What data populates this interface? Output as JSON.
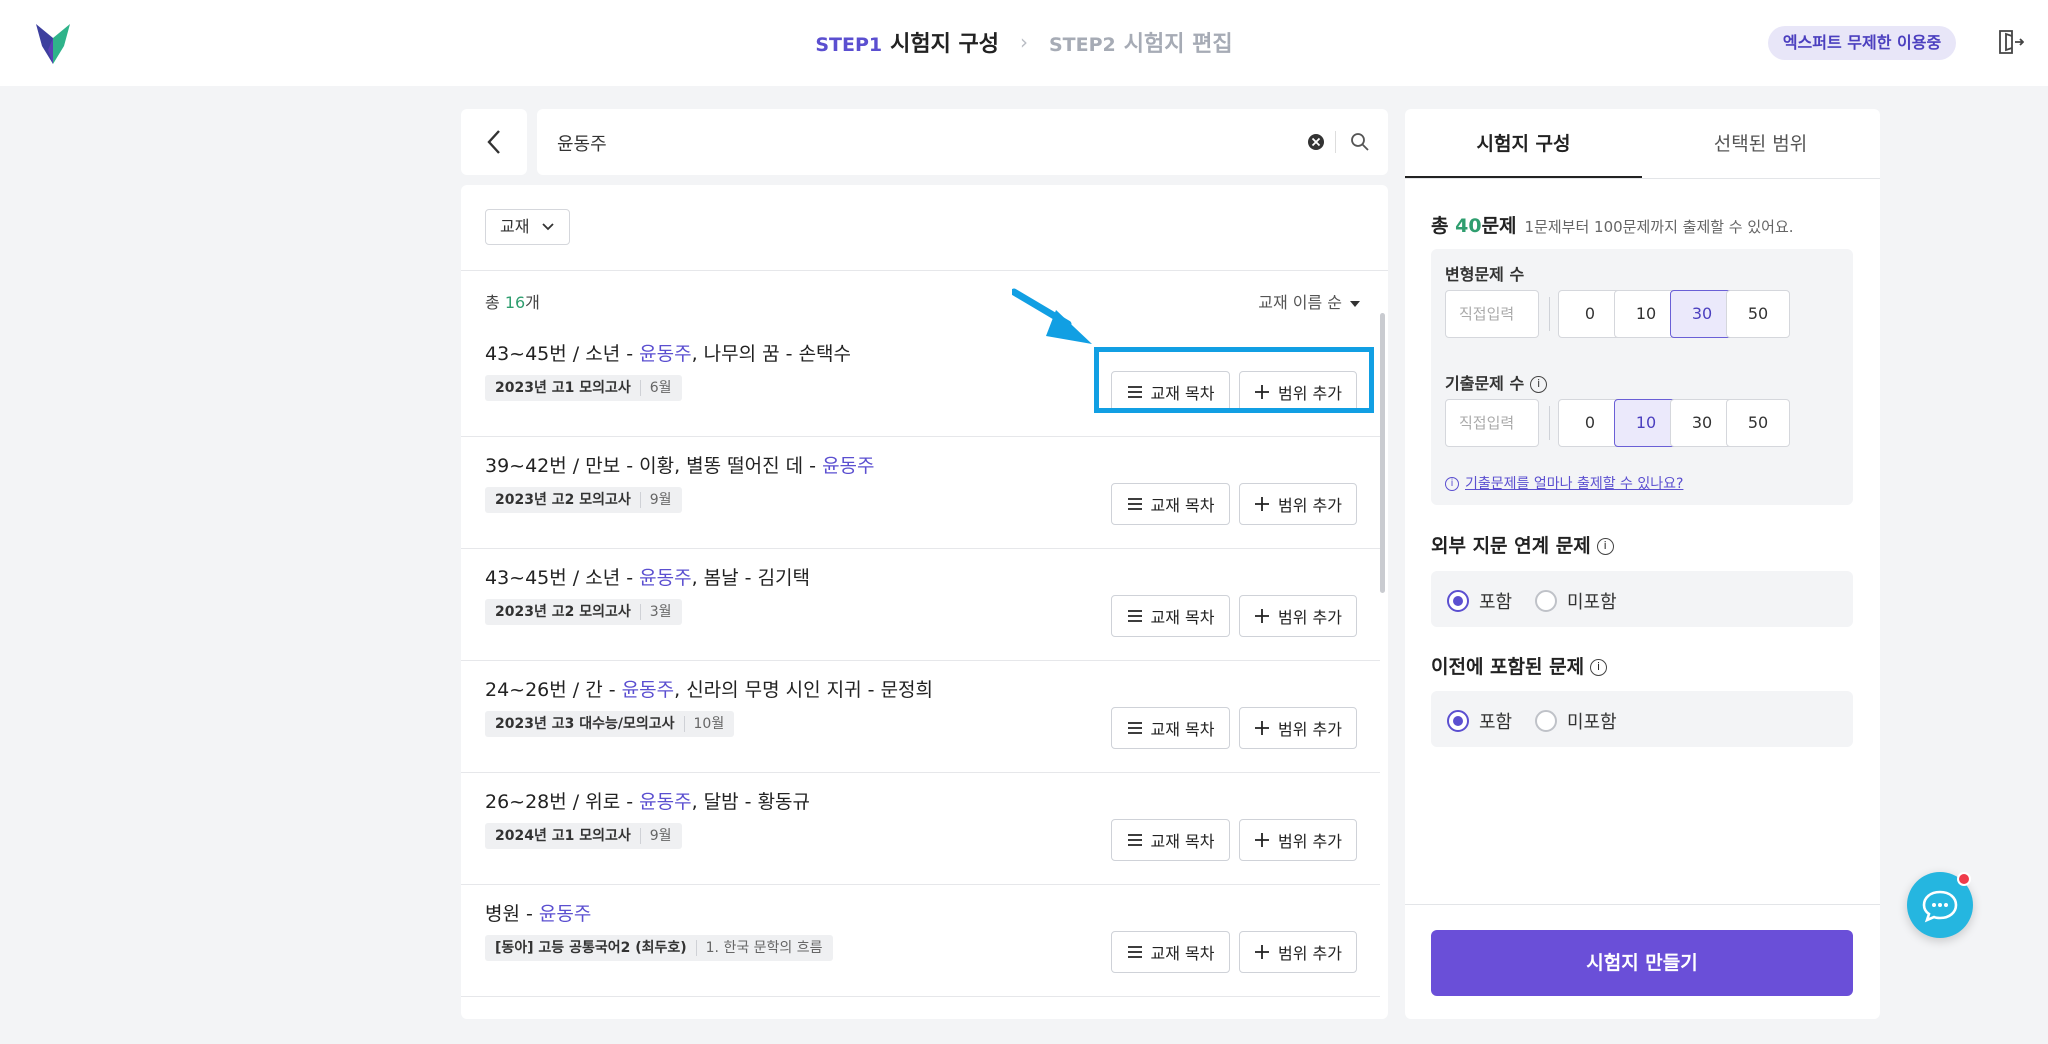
{
  "header": {
    "step1_num": "STEP1",
    "step1_title": "시험지 구성",
    "step2_num": "STEP2",
    "step2_title": "시험지 편집",
    "badge": "엑스퍼트 무제한 이용중",
    "logo_icon": "v-logo-icon",
    "logout_icon": "logout-icon"
  },
  "search": {
    "value": "윤동주"
  },
  "filter": {
    "dropdown_label": "교재",
    "count_prefix": "총 ",
    "count_num": "16",
    "count_suffix": "개",
    "sort_label": "교재 이름 순"
  },
  "list": {
    "toc_label": "교재 목차",
    "add_label": "범위 추가",
    "items": [
      {
        "pre": "43~45번 / 소년 - ",
        "hl": "윤동주",
        "post": ", 나무의 꿈 - 손택수",
        "tag_main": "2023년 고1 모의고사",
        "tag_sub": "6월"
      },
      {
        "pre": "39~42번 / 만보 - 이황, 별똥 떨어진 데 - ",
        "hl": "윤동주",
        "post": "",
        "tag_main": "2023년 고2 모의고사",
        "tag_sub": "9월"
      },
      {
        "pre": "43~45번 / 소년 - ",
        "hl": "윤동주",
        "post": ", 봄날 - 김기택",
        "tag_main": "2023년 고2 모의고사",
        "tag_sub": "3월"
      },
      {
        "pre": "24~26번 / 간 - ",
        "hl": "윤동주",
        "post": ", 신라의 무명 시인 지귀 - 문정희",
        "tag_main": "2023년 고3 대수능/모의고사",
        "tag_sub": "10월"
      },
      {
        "pre": "26~28번 / 위로 - ",
        "hl": "윤동주",
        "post": ", 달밤 - 황동규",
        "tag_main": "2024년 고1 모의고사",
        "tag_sub": "9월"
      },
      {
        "pre": "병원 - ",
        "hl": "윤동주",
        "post": "",
        "tag_main": "[동아] 고등 공통국어2 (최두호)",
        "tag_sub": "1. 한국 문학의 흐름"
      }
    ]
  },
  "right": {
    "tab_compose": "시험지 구성",
    "tab_selected": "선택된 범위",
    "total_prefix": "총 ",
    "total_num": "40",
    "total_suffix": "문제",
    "total_hint": "1문제부터 100문제까지 출제할 수 있어요.",
    "variant_label": "변형문제 수",
    "past_label": "기출문제 수",
    "input_placeholder": "직접입력",
    "options": [
      "0",
      "10",
      "30",
      "50"
    ],
    "variant_selected": "30",
    "past_selected": "10",
    "info_link": "기출문제를 얼마나 출제할 수 있나요?",
    "external_title": "외부 지문 연계 문제",
    "previous_title": "이전에 포함된 문제",
    "include": "포함",
    "exclude": "미포함",
    "create_button": "시험지 만들기"
  },
  "colors": {
    "accent": "#5b4fd0",
    "button": "#6a4fd8",
    "count_green": "#2f9e6f",
    "annotation_blue": "#119fe3",
    "chat": "#25b6e0"
  }
}
